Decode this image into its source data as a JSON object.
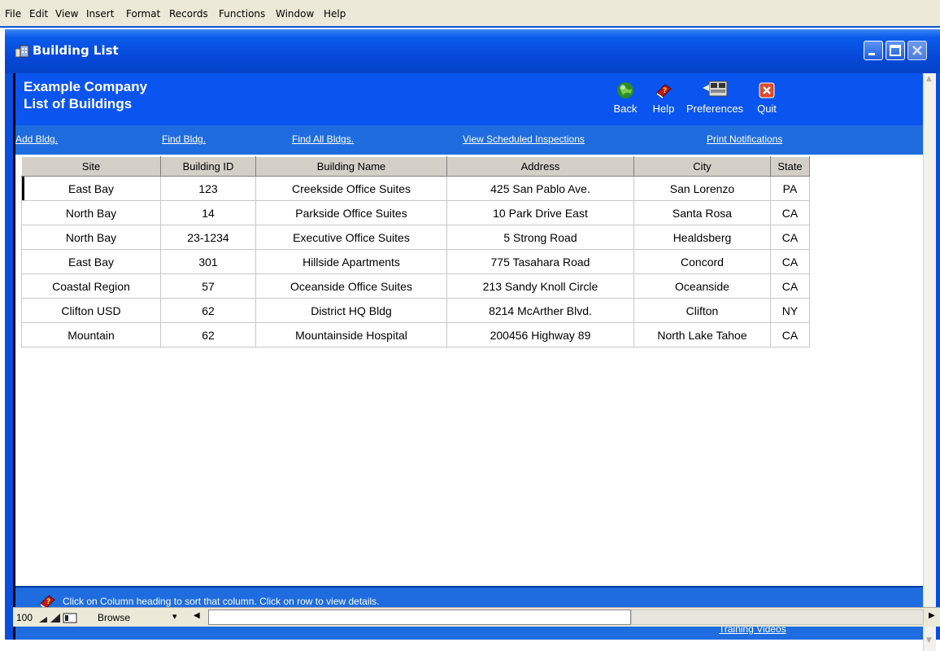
{
  "menu": [
    "File",
    "Edit",
    "View",
    "Insert",
    "Format",
    "Records",
    "Functions",
    "Window",
    "Help"
  ],
  "window": {
    "title": "Building List"
  },
  "header": {
    "company": "Example Company",
    "subtitle": "List of Buildings",
    "tools": [
      {
        "label": "Back",
        "icon": "globe-icon"
      },
      {
        "label": "Help",
        "icon": "help-book-icon"
      },
      {
        "label": "Preferences",
        "icon": "preferences-icon"
      },
      {
        "label": "Quit",
        "icon": "quit-icon"
      }
    ]
  },
  "links": {
    "add": "Add Bldg.",
    "find": "Find Bldg.",
    "find_all": "Find All Bldgs.",
    "scheduled": "View Scheduled Inspections",
    "print": "Print Notifications"
  },
  "table": {
    "columns": [
      "Site",
      "Building ID",
      "Building Name",
      "Address",
      "City",
      "State"
    ],
    "rows": [
      [
        "East Bay",
        "123",
        "Creekside Office Suites",
        "425 San Pablo Ave.",
        "San Lorenzo",
        "PA"
      ],
      [
        "North Bay",
        "14",
        "Parkside Office Suites",
        "10 Park Drive East",
        "Santa Rosa",
        "CA"
      ],
      [
        "North Bay",
        "23-1234",
        "Executive Office Suites",
        "5 Strong Road",
        "Healdsberg",
        "CA"
      ],
      [
        "East Bay",
        "301",
        "Hillside Apartments",
        "775 Tasahara Road",
        "Concord",
        "CA"
      ],
      [
        "Coastal Region",
        "57",
        "Oceanside Office Suites",
        "213 Sandy Knoll Circle",
        "Oceanside",
        "CA"
      ],
      [
        "Clifton USD",
        "62",
        "District HQ Bldg",
        "8214 McArther Blvd.",
        "Clifton",
        "NY"
      ],
      [
        "Mountain",
        "62",
        "Mountainside Hospital",
        "200456 Highway 89",
        "North Lake Tahoe",
        "CA"
      ]
    ]
  },
  "footer": {
    "hint": "Click on Column heading to sort that column.  Click on row to view details.",
    "training": "Training Videos"
  },
  "status": {
    "zoom": "100",
    "mode": "Browse"
  },
  "colors": {
    "header_bg": "#0A54F0",
    "linkbar_bg": "#1E6CE0",
    "title_bg": "#0549DA"
  }
}
